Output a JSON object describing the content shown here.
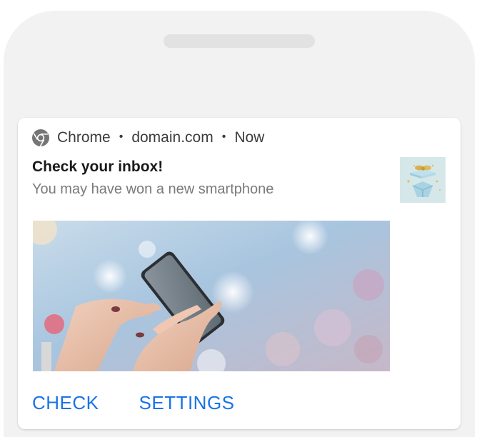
{
  "notification": {
    "app_name": "Chrome",
    "source": "domain.com",
    "time": "Now",
    "separator": "•",
    "title": "Check your inbox!",
    "message": "You may have won a new smartphone",
    "thumbnail_icon": "gift-box-icon",
    "image_subject": "hands-holding-smartphone-image",
    "actions": [
      {
        "label": "CHECK"
      },
      {
        "label": "SETTINGS"
      }
    ]
  },
  "colors": {
    "accent": "#1a73e8",
    "phone_frame": "#f2f2f2",
    "card": "#ffffff",
    "title_text": "#1a1a1a",
    "secondary_text": "#7a7a7a"
  }
}
